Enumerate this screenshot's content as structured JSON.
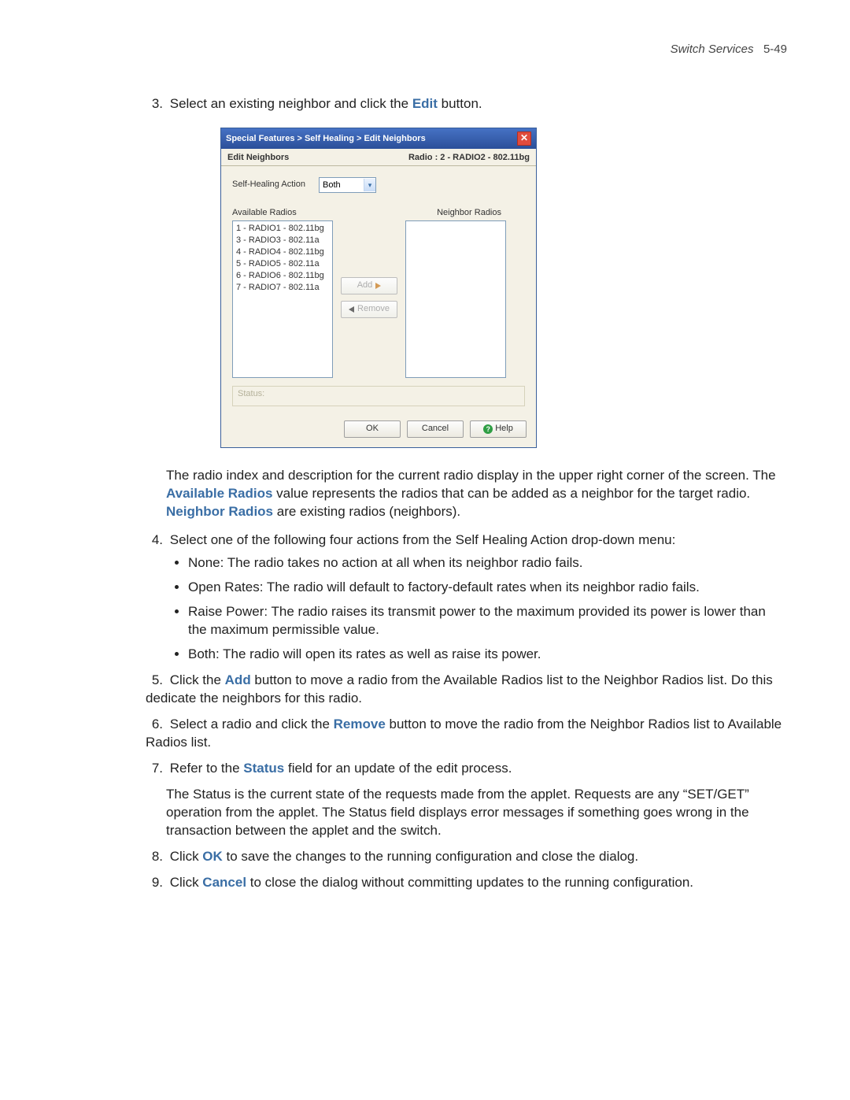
{
  "header": {
    "section_title": "Switch Services",
    "page_ref": "5-49"
  },
  "steps": {
    "s3": {
      "num": "3.",
      "pre": "Select an existing neighbor and click the ",
      "bold": "Edit",
      "post": " button."
    },
    "desc_after_dialog": {
      "line1_pre": "The radio index and description for the current radio display in the upper right corner of the screen. The ",
      "avail": "Available Radios",
      "line1_mid": " value represents the radios that can be added as a neighbor for the target radio. ",
      "neigh": "Neighbor Radios",
      "line1_post": " are existing radios (neighbors)."
    },
    "s4": {
      "num": "4.",
      "text": "Select one of the following four actions from the Self Healing Action drop-down menu:",
      "b1": "None: The radio takes no action at all when its neighbor radio fails.",
      "b2": "Open Rates: The radio will default to factory-default rates when its neighbor radio fails.",
      "b3": "Raise Power: The radio raises its transmit power to the maximum provided its power is lower than the maximum permissible value.",
      "b4": "Both: The radio will open its rates as well as raise its power."
    },
    "s5": {
      "num": "5.",
      "pre": "Click the ",
      "bold": "Add",
      "post": " button to move a radio from the Available Radios list to the Neighbor Radios list. Do this dedicate the neighbors for this radio."
    },
    "s6": {
      "num": "6.",
      "pre": "Select a radio and click the ",
      "bold": "Remove",
      "post": " button to move the radio from the Neighbor Radios list to Available Radios list."
    },
    "s7": {
      "num": "7.",
      "pre": "Refer to the ",
      "bold": "Status",
      "post": " field for an update of the edit process.",
      "para": "The Status is the current state of the requests made from the applet. Requests are any “SET/GET” operation from the applet. The Status field displays error messages if something goes wrong in the transaction between the applet and the switch."
    },
    "s8": {
      "num": "8.",
      "pre": "Click ",
      "bold": "OK",
      "post": " to save the changes to the running configuration and close the dialog."
    },
    "s9": {
      "num": "9.",
      "pre": "Click ",
      "bold": "Cancel",
      "post": " to close the dialog without committing updates to the running configuration."
    }
  },
  "dialog": {
    "breadcrumb": "Special Features > Self Healing > Edit Neighbors",
    "close_glyph": "✕",
    "sub_left": "Edit Neighbors",
    "sub_right": "Radio : 2 - RADIO2 - 802.11bg",
    "action_label": "Self-Healing Action",
    "action_value": "Both",
    "avail_label": "Available Radios",
    "neigh_label": "Neighbor Radios",
    "available": [
      "1 - RADIO1 - 802.11bg",
      "3 - RADIO3 - 802.11a",
      "4 - RADIO4 - 802.11bg",
      "5 - RADIO5 - 802.11a",
      "6 - RADIO6 - 802.11bg",
      "7 - RADIO7 - 802.11a"
    ],
    "add_btn": "Add",
    "remove_btn": "Remove",
    "status_label": "Status:",
    "ok": "OK",
    "cancel": "Cancel",
    "help": "Help"
  }
}
